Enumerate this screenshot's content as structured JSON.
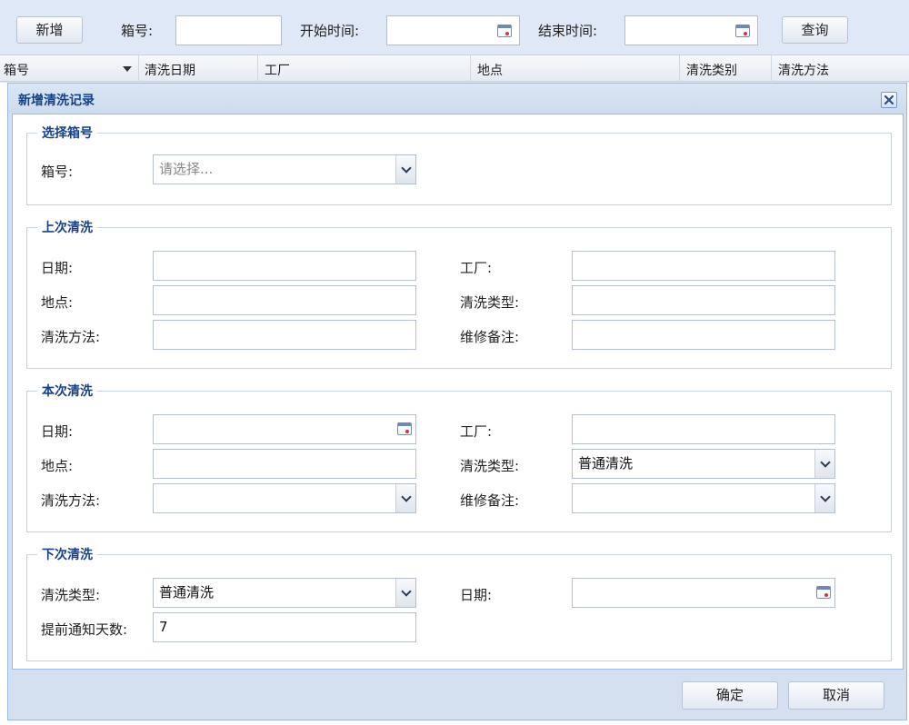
{
  "toolbar": {
    "add_label": "新增",
    "box_label": "箱号:",
    "start_label": "开始时间:",
    "end_label": "结束时间:",
    "query_label": "查询"
  },
  "grid": {
    "columns": [
      "箱号",
      "清洗日期",
      "工厂",
      "地点",
      "清洗类别",
      "清洗方法"
    ]
  },
  "dialog": {
    "title": "新增清洗记录",
    "select_section": {
      "legend": "选择箱号",
      "box_label": "箱号:",
      "box_placeholder": "请选择..."
    },
    "last_section": {
      "legend": "上次清洗",
      "date_label": "日期:",
      "factory_label": "工厂:",
      "location_label": "地点:",
      "clean_type_label": "清洗类型:",
      "method_label": "清洗方法:",
      "repair_label": "维修备注:"
    },
    "current_section": {
      "legend": "本次清洗",
      "date_label": "日期:",
      "factory_label": "工厂:",
      "location_label": "地点:",
      "clean_type_label": "清洗类型:",
      "clean_type_value": "普通清洗",
      "method_label": "清洗方法:",
      "repair_label": "维修备注:"
    },
    "next_section": {
      "legend": "下次清洗",
      "clean_type_label": "清洗类型:",
      "clean_type_value": "普通清洗",
      "date_label": "日期:",
      "notify_label": "提前通知天数:",
      "notify_value": "7"
    },
    "ok_label": "确定",
    "cancel_label": "取消"
  },
  "icons": [
    "calendar-icon",
    "chevron-down-icon",
    "close-icon",
    "sort-arrow-icon"
  ]
}
